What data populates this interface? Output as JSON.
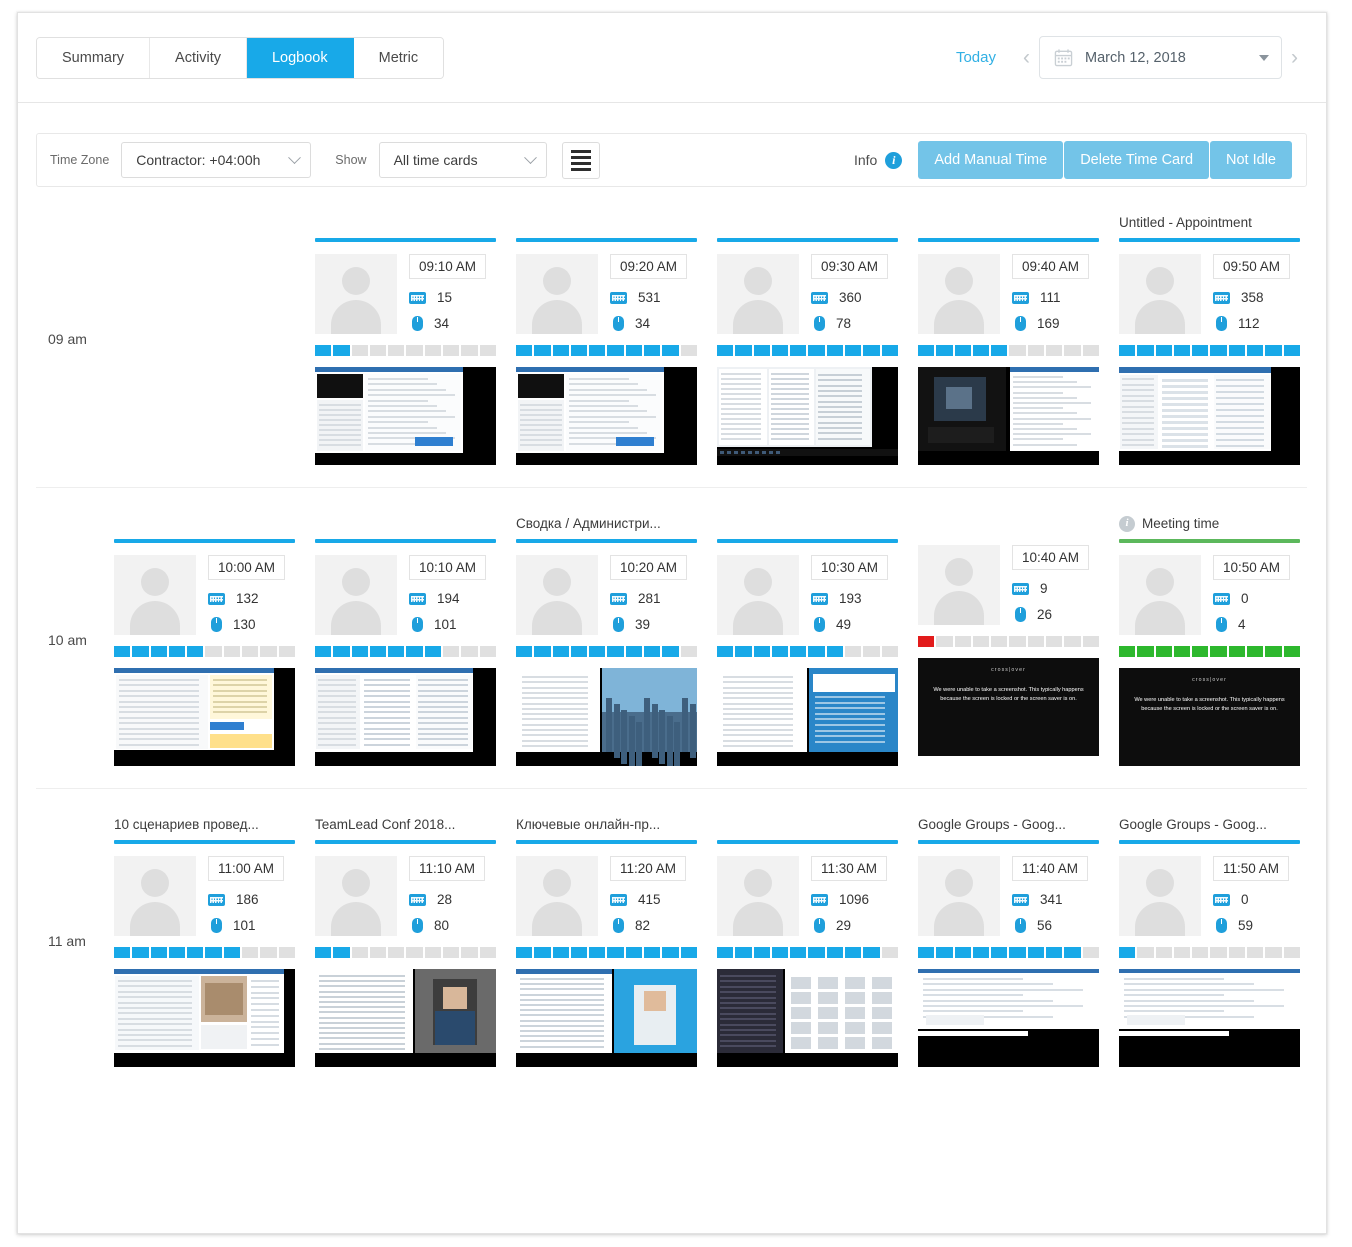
{
  "header": {
    "tabs": [
      {
        "label": "Summary",
        "active": false
      },
      {
        "label": "Activity",
        "active": false
      },
      {
        "label": "Logbook",
        "active": true
      },
      {
        "label": "Metric",
        "active": false
      }
    ],
    "today_label": "Today",
    "prev_arrow": "‹",
    "next_arrow": "›",
    "date_value": "March 12, 2018"
  },
  "toolbar": {
    "timezone_label": "Time Zone",
    "timezone_value": "Contractor: +04:00h",
    "show_label": "Show",
    "show_value": "All time cards",
    "menu_icon": "hamburger-icon",
    "info_label": "Info",
    "info_icon": "info-icon",
    "buttons": [
      {
        "label": "Add Manual Time"
      },
      {
        "label": "Delete Time Card"
      },
      {
        "label": "Not Idle"
      }
    ]
  },
  "colors": {
    "accent_blue": "#18a9e8",
    "button_blue": "#73c4e8",
    "meeting_green": "#5cb85c",
    "idle_red": "#e21b1b",
    "today_link": "#31b0e4"
  },
  "screenshot_unavailable": {
    "logo": "cross|over",
    "message": "We were unable to take a screenshot. This typically happens because the screen is locked or the screen saver is on."
  },
  "rows": [
    {
      "hour": "09 am",
      "cards": [
        {
          "title": "",
          "blurred": true,
          "accent": "blue",
          "time": "09:10 AM",
          "keyboard": 15,
          "mouse": 34,
          "segments": 10,
          "filled": 2,
          "seg_color": "blue",
          "thumb": "app-window",
          "has_info": false
        },
        {
          "title": "",
          "blurred": true,
          "accent": "blue",
          "time": "09:20 AM",
          "keyboard": 531,
          "mouse": 34,
          "segments": 10,
          "filled": 9,
          "seg_color": "blue",
          "thumb": "app-window",
          "has_info": false
        },
        {
          "title": "",
          "blurred": true,
          "accent": "blue",
          "time": "09:30 AM",
          "keyboard": 360,
          "mouse": 78,
          "segments": 10,
          "filled": 10,
          "seg_color": "blue",
          "thumb": "code-window",
          "has_info": false
        },
        {
          "title": "",
          "blurred": true,
          "accent": "blue",
          "time": "09:40 AM",
          "keyboard": 111,
          "mouse": 169,
          "segments": 10,
          "filled": 5,
          "seg_color": "blue",
          "thumb": "video-window",
          "has_info": false
        },
        {
          "title": "Untitled - Appointment",
          "blurred": false,
          "accent": "blue",
          "time": "09:50 AM",
          "keyboard": 358,
          "mouse": 112,
          "segments": 10,
          "filled": 10,
          "seg_color": "blue",
          "thumb": "mail-window",
          "has_info": false
        }
      ]
    },
    {
      "hour": "10 am",
      "cards": [
        {
          "title": "",
          "blurred": true,
          "accent": "blue",
          "time": "10:00 AM",
          "keyboard": 132,
          "mouse": 130,
          "segments": 10,
          "filled": 5,
          "seg_color": "blue",
          "thumb": "form-window",
          "has_info": false
        },
        {
          "title": "",
          "blurred": true,
          "accent": "blue",
          "time": "10:10 AM",
          "keyboard": 194,
          "mouse": 101,
          "segments": 10,
          "filled": 7,
          "seg_color": "blue",
          "thumb": "list-window",
          "has_info": false
        },
        {
          "title": "Сводка / Администри...",
          "blurred": false,
          "accent": "blue",
          "time": "10:20 AM",
          "keyboard": 281,
          "mouse": 39,
          "segments": 10,
          "filled": 9,
          "seg_color": "blue",
          "thumb": "photo-window",
          "has_info": false
        },
        {
          "title": "",
          "blurred": false,
          "accent": "blue",
          "time": "10:30 AM",
          "keyboard": 193,
          "mouse": 49,
          "segments": 10,
          "filled": 7,
          "seg_color": "blue",
          "thumb": "photo2-window",
          "has_info": false
        },
        {
          "title": "",
          "blurred": false,
          "accent": "none",
          "time": "10:40 AM",
          "keyboard": 9,
          "mouse": 26,
          "segments": 10,
          "filled": 1,
          "seg_color": "red",
          "thumb": "locked",
          "has_info": false
        },
        {
          "title": "Meeting time",
          "blurred": false,
          "accent": "green",
          "time": "10:50 AM",
          "keyboard": 0,
          "mouse": 4,
          "segments": 10,
          "filled": 10,
          "seg_color": "green",
          "thumb": "locked",
          "has_info": true
        }
      ]
    },
    {
      "hour": "11 am",
      "cards": [
        {
          "title": "10 сценариев провед...",
          "blurred": false,
          "accent": "blue",
          "time": "11:00 AM",
          "keyboard": 186,
          "mouse": 101,
          "segments": 10,
          "filled": 7,
          "seg_color": "blue",
          "thumb": "doc-window",
          "has_info": false
        },
        {
          "title": "TeamLead Conf 2018...",
          "blurred": false,
          "accent": "blue",
          "time": "11:10 AM",
          "keyboard": 28,
          "mouse": 80,
          "segments": 10,
          "filled": 2,
          "seg_color": "blue",
          "thumb": "person-window",
          "has_info": false
        },
        {
          "title": "Ключевые онлайн-пр...",
          "blurred": false,
          "accent": "blue",
          "time": "11:20 AM",
          "keyboard": 415,
          "mouse": 82,
          "segments": 10,
          "filled": 10,
          "seg_color": "blue",
          "thumb": "person2-window",
          "has_info": false
        },
        {
          "title": "",
          "blurred": true,
          "accent": "blue",
          "time": "11:30 AM",
          "keyboard": 1096,
          "mouse": 29,
          "segments": 10,
          "filled": 9,
          "seg_color": "blue",
          "thumb": "dark-window",
          "has_info": false
        },
        {
          "title": "Google Groups - Goog...",
          "blurred": false,
          "accent": "blue",
          "time": "11:40 AM",
          "keyboard": 341,
          "mouse": 56,
          "segments": 10,
          "filled": 9,
          "seg_color": "blue",
          "thumb": "groups-window",
          "has_info": false
        },
        {
          "title": "Google Groups - Goog...",
          "blurred": false,
          "accent": "blue",
          "time": "11:50 AM",
          "keyboard": 0,
          "mouse": 59,
          "segments": 10,
          "filled": 1,
          "seg_color": "blue",
          "thumb": "groups-window",
          "has_info": false
        }
      ]
    }
  ]
}
